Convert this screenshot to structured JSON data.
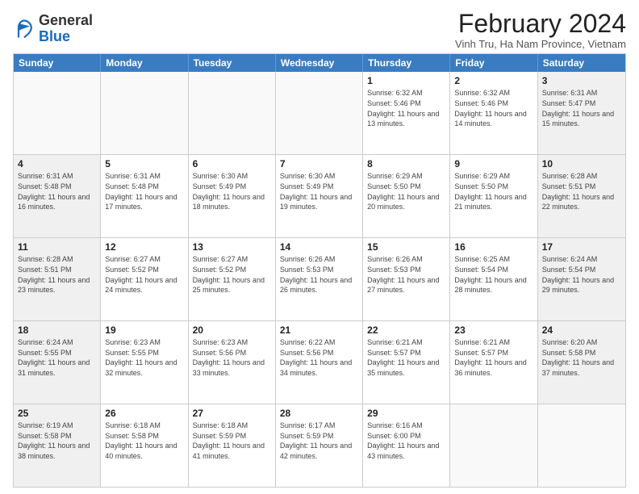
{
  "logo": {
    "general": "General",
    "blue": "Blue"
  },
  "header": {
    "title": "February 2024",
    "subtitle": "Vinh Tru, Ha Nam Province, Vietnam"
  },
  "days": [
    "Sunday",
    "Monday",
    "Tuesday",
    "Wednesday",
    "Thursday",
    "Friday",
    "Saturday"
  ],
  "rows": [
    [
      {
        "num": "",
        "info": ""
      },
      {
        "num": "",
        "info": ""
      },
      {
        "num": "",
        "info": ""
      },
      {
        "num": "",
        "info": ""
      },
      {
        "num": "1",
        "info": "Sunrise: 6:32 AM\nSunset: 5:46 PM\nDaylight: 11 hours and 13 minutes."
      },
      {
        "num": "2",
        "info": "Sunrise: 6:32 AM\nSunset: 5:46 PM\nDaylight: 11 hours and 14 minutes."
      },
      {
        "num": "3",
        "info": "Sunrise: 6:31 AM\nSunset: 5:47 PM\nDaylight: 11 hours and 15 minutes."
      }
    ],
    [
      {
        "num": "4",
        "info": "Sunrise: 6:31 AM\nSunset: 5:48 PM\nDaylight: 11 hours and 16 minutes."
      },
      {
        "num": "5",
        "info": "Sunrise: 6:31 AM\nSunset: 5:48 PM\nDaylight: 11 hours and 17 minutes."
      },
      {
        "num": "6",
        "info": "Sunrise: 6:30 AM\nSunset: 5:49 PM\nDaylight: 11 hours and 18 minutes."
      },
      {
        "num": "7",
        "info": "Sunrise: 6:30 AM\nSunset: 5:49 PM\nDaylight: 11 hours and 19 minutes."
      },
      {
        "num": "8",
        "info": "Sunrise: 6:29 AM\nSunset: 5:50 PM\nDaylight: 11 hours and 20 minutes."
      },
      {
        "num": "9",
        "info": "Sunrise: 6:29 AM\nSunset: 5:50 PM\nDaylight: 11 hours and 21 minutes."
      },
      {
        "num": "10",
        "info": "Sunrise: 6:28 AM\nSunset: 5:51 PM\nDaylight: 11 hours and 22 minutes."
      }
    ],
    [
      {
        "num": "11",
        "info": "Sunrise: 6:28 AM\nSunset: 5:51 PM\nDaylight: 11 hours and 23 minutes."
      },
      {
        "num": "12",
        "info": "Sunrise: 6:27 AM\nSunset: 5:52 PM\nDaylight: 11 hours and 24 minutes."
      },
      {
        "num": "13",
        "info": "Sunrise: 6:27 AM\nSunset: 5:52 PM\nDaylight: 11 hours and 25 minutes."
      },
      {
        "num": "14",
        "info": "Sunrise: 6:26 AM\nSunset: 5:53 PM\nDaylight: 11 hours and 26 minutes."
      },
      {
        "num": "15",
        "info": "Sunrise: 6:26 AM\nSunset: 5:53 PM\nDaylight: 11 hours and 27 minutes."
      },
      {
        "num": "16",
        "info": "Sunrise: 6:25 AM\nSunset: 5:54 PM\nDaylight: 11 hours and 28 minutes."
      },
      {
        "num": "17",
        "info": "Sunrise: 6:24 AM\nSunset: 5:54 PM\nDaylight: 11 hours and 29 minutes."
      }
    ],
    [
      {
        "num": "18",
        "info": "Sunrise: 6:24 AM\nSunset: 5:55 PM\nDaylight: 11 hours and 31 minutes."
      },
      {
        "num": "19",
        "info": "Sunrise: 6:23 AM\nSunset: 5:55 PM\nDaylight: 11 hours and 32 minutes."
      },
      {
        "num": "20",
        "info": "Sunrise: 6:23 AM\nSunset: 5:56 PM\nDaylight: 11 hours and 33 minutes."
      },
      {
        "num": "21",
        "info": "Sunrise: 6:22 AM\nSunset: 5:56 PM\nDaylight: 11 hours and 34 minutes."
      },
      {
        "num": "22",
        "info": "Sunrise: 6:21 AM\nSunset: 5:57 PM\nDaylight: 11 hours and 35 minutes."
      },
      {
        "num": "23",
        "info": "Sunrise: 6:21 AM\nSunset: 5:57 PM\nDaylight: 11 hours and 36 minutes."
      },
      {
        "num": "24",
        "info": "Sunrise: 6:20 AM\nSunset: 5:58 PM\nDaylight: 11 hours and 37 minutes."
      }
    ],
    [
      {
        "num": "25",
        "info": "Sunrise: 6:19 AM\nSunset: 5:58 PM\nDaylight: 11 hours and 38 minutes."
      },
      {
        "num": "26",
        "info": "Sunrise: 6:18 AM\nSunset: 5:58 PM\nDaylight: 11 hours and 40 minutes."
      },
      {
        "num": "27",
        "info": "Sunrise: 6:18 AM\nSunset: 5:59 PM\nDaylight: 11 hours and 41 minutes."
      },
      {
        "num": "28",
        "info": "Sunrise: 6:17 AM\nSunset: 5:59 PM\nDaylight: 11 hours and 42 minutes."
      },
      {
        "num": "29",
        "info": "Sunrise: 6:16 AM\nSunset: 6:00 PM\nDaylight: 11 hours and 43 minutes."
      },
      {
        "num": "",
        "info": ""
      },
      {
        "num": "",
        "info": ""
      }
    ]
  ]
}
